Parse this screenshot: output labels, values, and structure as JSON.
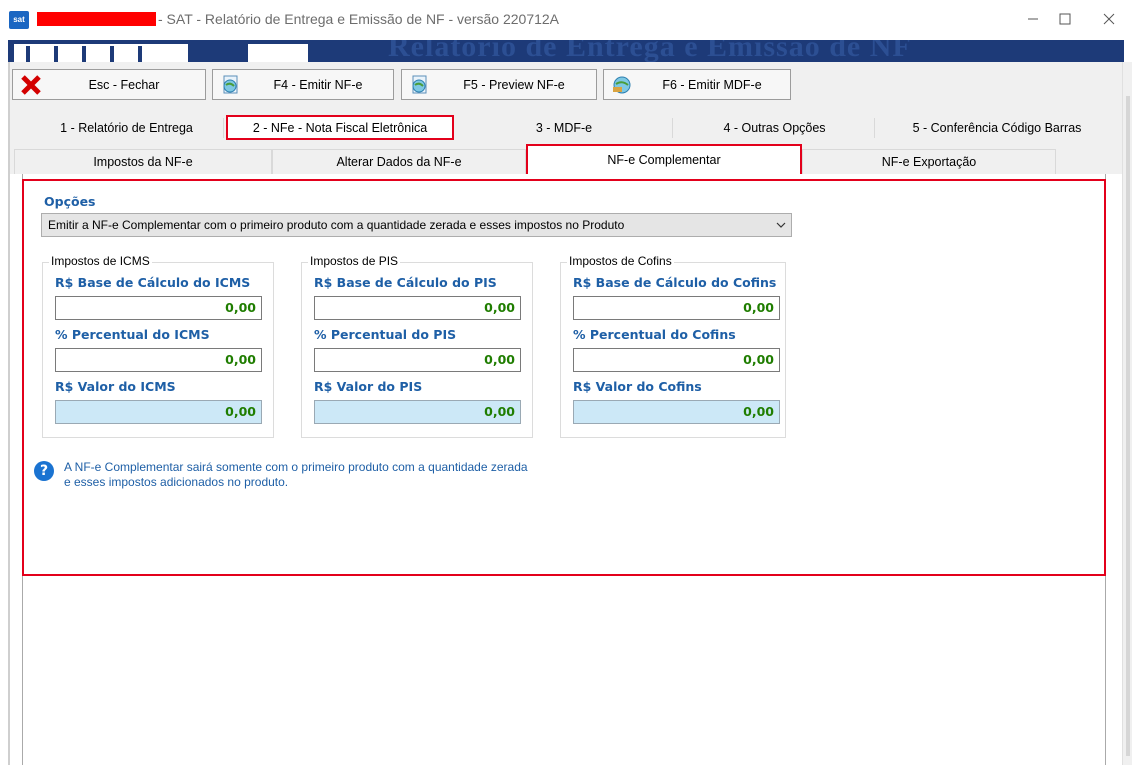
{
  "window": {
    "app_icon_text": "sat",
    "title": "- SAT - Relatório de Entrega e Emissão de NF - versão 220712A"
  },
  "banner": {
    "faint_text": "Relatório de Entrega e Emissão de NF"
  },
  "toolbar": {
    "buttons": [
      {
        "label": "Esc - Fechar",
        "icon": "close-x-icon"
      },
      {
        "label": "F4 - Emitir NF-e",
        "icon": "globe-document-icon"
      },
      {
        "label": "F5 - Preview NF-e",
        "icon": "globe-document-icon"
      },
      {
        "label": "F6 - Emitir MDF-e",
        "icon": "globe-truck-icon"
      }
    ]
  },
  "main_tabs": [
    "1 - Relatório de Entrega",
    "2 - NFe - Nota Fiscal Eletrônica",
    "3 - MDF-e",
    "4 - Outras Opções",
    "5 - Conferência Código Barras"
  ],
  "main_tabs_selected": "2 - NFe - Nota Fiscal Eletrônica",
  "sub_tabs": [
    "Impostos da NF-e",
    "Alterar Dados da NF-e",
    "NF-e Complementar",
    "NF-e Exportação"
  ],
  "sub_tabs_selected": "NF-e Complementar",
  "options": {
    "label": "Opções",
    "selected": "Emitir a NF-e Complementar com o primeiro produto com a quantidade zerada e esses impostos no Produto"
  },
  "groups": [
    {
      "title": "Impostos de ICMS",
      "fields": [
        {
          "label": "R$ Base de Cálculo do ICMS",
          "value": "0,00"
        },
        {
          "label": "% Percentual do ICMS",
          "value": "0,00"
        },
        {
          "label": "R$ Valor do ICMS",
          "value": "0,00"
        }
      ]
    },
    {
      "title": "Impostos de PIS",
      "fields": [
        {
          "label": "R$ Base de Cálculo do PIS",
          "value": "0,00"
        },
        {
          "label": "% Percentual do PIS",
          "value": "0,00"
        },
        {
          "label": "R$ Valor do PIS",
          "value": "0,00"
        }
      ]
    },
    {
      "title": "Impostos de Cofins",
      "fields": [
        {
          "label": "R$ Base de Cálculo do Cofins",
          "value": "0,00"
        },
        {
          "label": "% Percentual do Cofins",
          "value": "0,00"
        },
        {
          "label": "R$ Valor do Cofins",
          "value": "0,00"
        }
      ]
    }
  ],
  "help": {
    "icon": "question-icon",
    "text": "A NF-e Complementar sairá somente com o primeiro produto com a quantidade zerada e esses impostos adicionados no produto."
  },
  "colors": {
    "label_blue": "#1e5fa6",
    "value_green": "#1f7d00",
    "highlight_red": "#e3001b",
    "calc_field_bg": "#cce8f7",
    "banner_navy": "#1d3a78"
  }
}
